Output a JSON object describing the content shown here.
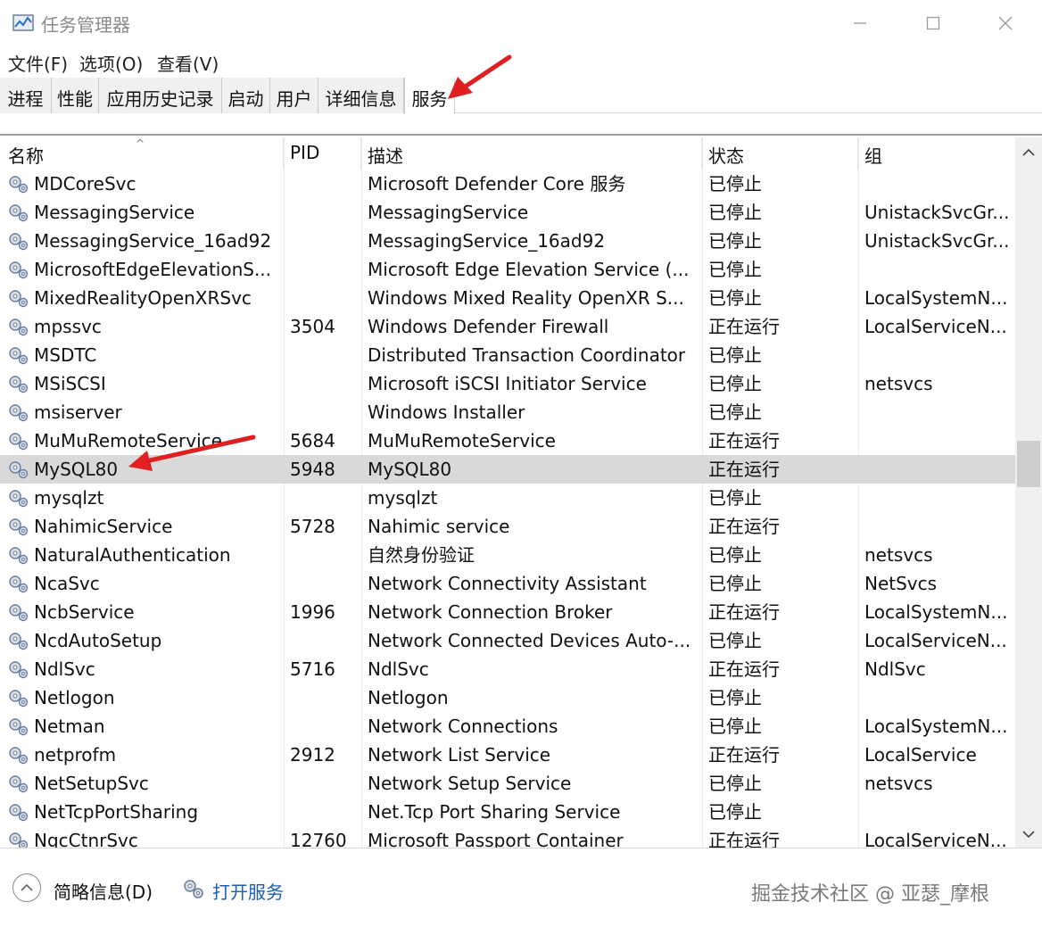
{
  "window": {
    "title": "任务管理器"
  },
  "menu": [
    {
      "label": "文件(F)"
    },
    {
      "label": "选项(O)"
    },
    {
      "label": "查看(V)"
    }
  ],
  "tabs": [
    {
      "label": "进程",
      "active": false
    },
    {
      "label": "性能",
      "active": false
    },
    {
      "label": "应用历史记录",
      "active": false
    },
    {
      "label": "启动",
      "active": false
    },
    {
      "label": "用户",
      "active": false
    },
    {
      "label": "详细信息",
      "active": false
    },
    {
      "label": "服务",
      "active": true
    }
  ],
  "columns": {
    "name": "名称",
    "pid": "PID",
    "desc": "描述",
    "status": "状态",
    "group": "组"
  },
  "rows": [
    {
      "name": "MDCoreSvc",
      "pid": "",
      "desc": "Microsoft Defender Core 服务",
      "status": "已停止",
      "group": ""
    },
    {
      "name": "MessagingService",
      "pid": "",
      "desc": "MessagingService",
      "status": "已停止",
      "group": "UnistackSvcGr..."
    },
    {
      "name": "MessagingService_16ad92",
      "pid": "",
      "desc": "MessagingService_16ad92",
      "status": "已停止",
      "group": "UnistackSvcGr..."
    },
    {
      "name": "MicrosoftEdgeElevationS...",
      "pid": "",
      "desc": "Microsoft Edge Elevation Service (...",
      "status": "已停止",
      "group": ""
    },
    {
      "name": "MixedRealityOpenXRSvc",
      "pid": "",
      "desc": "Windows Mixed Reality OpenXR S...",
      "status": "已停止",
      "group": "LocalSystemN..."
    },
    {
      "name": "mpssvc",
      "pid": "3504",
      "desc": "Windows Defender Firewall",
      "status": "正在运行",
      "group": "LocalServiceN..."
    },
    {
      "name": "MSDTC",
      "pid": "",
      "desc": "Distributed Transaction Coordinator",
      "status": "已停止",
      "group": ""
    },
    {
      "name": "MSiSCSI",
      "pid": "",
      "desc": "Microsoft iSCSI Initiator Service",
      "status": "已停止",
      "group": "netsvcs"
    },
    {
      "name": "msiserver",
      "pid": "",
      "desc": "Windows Installer",
      "status": "已停止",
      "group": ""
    },
    {
      "name": "MuMuRemoteService",
      "pid": "5684",
      "desc": "MuMuRemoteService",
      "status": "正在运行",
      "group": ""
    },
    {
      "name": "MySQL80",
      "pid": "5948",
      "desc": "MySQL80",
      "status": "正在运行",
      "group": "",
      "selected": true
    },
    {
      "name": "mysqlzt",
      "pid": "",
      "desc": "mysqlzt",
      "status": "已停止",
      "group": ""
    },
    {
      "name": "NahimicService",
      "pid": "5728",
      "desc": "Nahimic service",
      "status": "正在运行",
      "group": ""
    },
    {
      "name": "NaturalAuthentication",
      "pid": "",
      "desc": "自然身份验证",
      "status": "已停止",
      "group": "netsvcs"
    },
    {
      "name": "NcaSvc",
      "pid": "",
      "desc": "Network Connectivity Assistant",
      "status": "已停止",
      "group": "NetSvcs"
    },
    {
      "name": "NcbService",
      "pid": "1996",
      "desc": "Network Connection Broker",
      "status": "正在运行",
      "group": "LocalSystemN..."
    },
    {
      "name": "NcdAutoSetup",
      "pid": "",
      "desc": "Network Connected Devices Auto-...",
      "status": "已停止",
      "group": "LocalServiceN..."
    },
    {
      "name": "NdlSvc",
      "pid": "5716",
      "desc": "NdlSvc",
      "status": "正在运行",
      "group": "NdlSvc"
    },
    {
      "name": "Netlogon",
      "pid": "",
      "desc": "Netlogon",
      "status": "已停止",
      "group": ""
    },
    {
      "name": "Netman",
      "pid": "",
      "desc": "Network Connections",
      "status": "已停止",
      "group": "LocalSystemN..."
    },
    {
      "name": "netprofm",
      "pid": "2912",
      "desc": "Network List Service",
      "status": "正在运行",
      "group": "LocalService"
    },
    {
      "name": "NetSetupSvc",
      "pid": "",
      "desc": "Network Setup Service",
      "status": "已停止",
      "group": "netsvcs"
    },
    {
      "name": "NetTcpPortSharing",
      "pid": "",
      "desc": "Net.Tcp Port Sharing Service",
      "status": "已停止",
      "group": ""
    },
    {
      "name": "NgcCtnrSvc",
      "pid": "12760",
      "desc": "Microsoft Passport Container",
      "status": "正在运行",
      "group": "LocalServiceN..."
    }
  ],
  "footer": {
    "fewer_details": "简略信息(D)",
    "open_services": "打开服务",
    "watermark": "掘金技术社区 @ 亚瑟_摩根"
  },
  "colors": {
    "selected_row": "#d9d9d9",
    "link": "#1a5fb4",
    "annotation_arrow": "#e02020"
  },
  "icons": [
    "task-manager-icon",
    "gear-service-icon",
    "minimize-icon",
    "maximize-icon",
    "close-icon",
    "chevron-up-icon",
    "chevron-down-icon",
    "collapse-circle-icon",
    "open-services-icon"
  ]
}
